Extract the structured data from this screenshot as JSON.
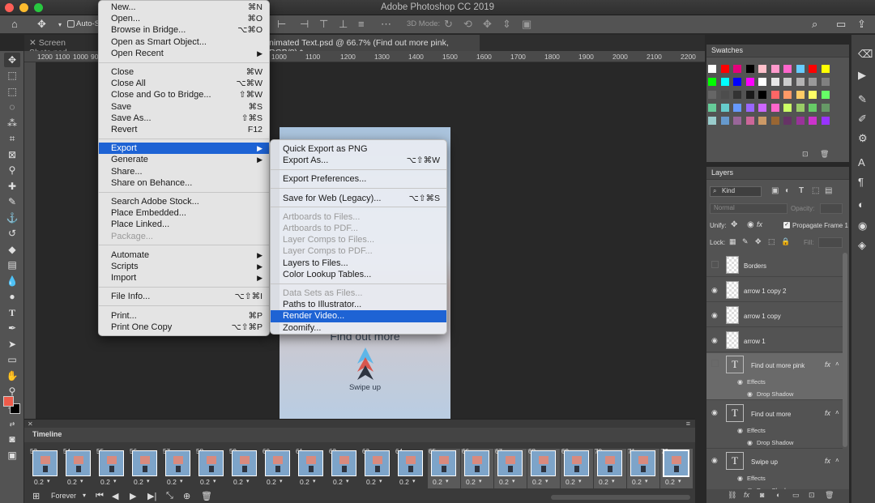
{
  "app": {
    "title": "Adobe Photoshop CC 2019"
  },
  "options": {
    "auto_select_label": "Auto-Se",
    "mode_3d": "3D Mode:"
  },
  "tabs": [
    {
      "label": "Screen Shots.psd"
    },
    {
      "label": "nimated Text.psd @ 66.7% (Find out more pink, RGB/8) *"
    }
  ],
  "ruler": [
    "1200",
    "1100",
    "1000",
    "900",
    "1000",
    "1100",
    "1200",
    "1300",
    "1400",
    "1500",
    "1600",
    "1700",
    "1800",
    "1900",
    "2000",
    "2100",
    "2200"
  ],
  "file_menu": {
    "groups": [
      [
        {
          "label": "New...",
          "shortcut": "⌘N"
        },
        {
          "label": "Open...",
          "shortcut": "⌘O"
        },
        {
          "label": "Browse in Bridge...",
          "shortcut": "⌥⌘O"
        },
        {
          "label": "Open as Smart Object...",
          "shortcut": ""
        },
        {
          "label": "Open Recent",
          "shortcut": "",
          "submenu": true
        }
      ],
      [
        {
          "label": "Close",
          "shortcut": "⌘W"
        },
        {
          "label": "Close All",
          "shortcut": "⌥⌘W"
        },
        {
          "label": "Close and Go to Bridge...",
          "shortcut": "⇧⌘W"
        },
        {
          "label": "Save",
          "shortcut": "⌘S"
        },
        {
          "label": "Save As...",
          "shortcut": "⇧⌘S"
        },
        {
          "label": "Revert",
          "shortcut": "F12"
        }
      ],
      [
        {
          "label": "Export",
          "shortcut": "",
          "submenu": true,
          "highlight": true
        },
        {
          "label": "Generate",
          "shortcut": "",
          "submenu": true
        },
        {
          "label": "Share...",
          "shortcut": ""
        },
        {
          "label": "Share on Behance...",
          "shortcut": ""
        }
      ],
      [
        {
          "label": "Search Adobe Stock...",
          "shortcut": ""
        },
        {
          "label": "Place Embedded...",
          "shortcut": ""
        },
        {
          "label": "Place Linked...",
          "shortcut": ""
        },
        {
          "label": "Package...",
          "shortcut": "",
          "disabled": true
        }
      ],
      [
        {
          "label": "Automate",
          "shortcut": "",
          "submenu": true
        },
        {
          "label": "Scripts",
          "shortcut": "",
          "submenu": true
        },
        {
          "label": "Import",
          "shortcut": "",
          "submenu": true
        }
      ],
      [
        {
          "label": "File Info...",
          "shortcut": "⌥⇧⌘I"
        }
      ],
      [
        {
          "label": "Print...",
          "shortcut": "⌘P"
        },
        {
          "label": "Print One Copy",
          "shortcut": "⌥⇧⌘P"
        }
      ]
    ]
  },
  "export_menu": {
    "groups": [
      [
        {
          "label": "Quick Export as PNG",
          "shortcut": ""
        },
        {
          "label": "Export As...",
          "shortcut": "⌥⇧⌘W"
        }
      ],
      [
        {
          "label": "Export Preferences...",
          "shortcut": ""
        }
      ],
      [
        {
          "label": "Save for Web (Legacy)...",
          "shortcut": "⌥⇧⌘S"
        }
      ],
      [
        {
          "label": "Artboards to Files...",
          "shortcut": "",
          "disabled": true
        },
        {
          "label": "Artboards to PDF...",
          "shortcut": "",
          "disabled": true
        },
        {
          "label": "Layer Comps to Files...",
          "shortcut": "",
          "disabled": true
        },
        {
          "label": "Layer Comps to PDF...",
          "shortcut": "",
          "disabled": true
        },
        {
          "label": "Layers to Files...",
          "shortcut": ""
        },
        {
          "label": "Color Lookup Tables...",
          "shortcut": ""
        }
      ],
      [
        {
          "label": "Data Sets as Files...",
          "shortcut": "",
          "disabled": true
        },
        {
          "label": "Paths to Illustrator...",
          "shortcut": ""
        },
        {
          "label": "Render Video...",
          "shortcut": "",
          "highlight": true
        },
        {
          "label": "Zoomify...",
          "shortcut": ""
        }
      ]
    ]
  },
  "artboard": {
    "cta": "Find out more",
    "swipe": "Swipe up"
  },
  "timeline": {
    "title": "Timeline",
    "loop": "Forever",
    "frames": [
      "53",
      "54",
      "55",
      "56",
      "57",
      "58",
      "59",
      "60",
      "61",
      "62",
      "63",
      "64",
      "65",
      "66",
      "67",
      "68",
      "69",
      "70",
      "71",
      "72"
    ],
    "duration": "0.2"
  },
  "swatches": {
    "title": "Swatches",
    "colors": [
      "#ffffff",
      "#ff0000",
      "#e4007c",
      "#000000",
      "#ffc0cb",
      "#ff99cc",
      "#ff66cc",
      "#66ccff",
      "#ff0000",
      "#ffff00",
      "#00ff00",
      "#00ffff",
      "#0000ff",
      "#ff00ff",
      "#ffffff",
      "#e6e6e6",
      "#cccccc",
      "#b3b3b3",
      "#999999",
      "#808080",
      "#666666",
      "#4d4d4d",
      "#333333",
      "#1a1a1a",
      "#000000",
      "#ff6666",
      "#ff9966",
      "#ffcc66",
      "#ffff66",
      "#66ff66",
      "#66cc99",
      "#66cccc",
      "#6699ff",
      "#9966ff",
      "#cc66ff",
      "#ff66cc",
      "#ccff66",
      "#99cc66",
      "#66cc66",
      "#669966",
      "#99cccc",
      "#6699cc",
      "#996699",
      "#cc6699",
      "#cc9966",
      "#996633",
      "#663366",
      "#993399",
      "#cc33cc",
      "#9933ff"
    ]
  },
  "layers": {
    "title": "Layers",
    "filter": "Kind",
    "blend": "Normal",
    "opacity_label": "Opacity:",
    "unify_label": "Unify:",
    "propagate_label": "Propagate Frame 1",
    "lock_label": "Lock:",
    "fill_label": "Fill:",
    "items": [
      {
        "name": "Borders",
        "type": "pixel",
        "visible": false
      },
      {
        "name": "arrow 1 copy 2",
        "type": "pixel",
        "visible": true
      },
      {
        "name": "arrow 1 copy",
        "type": "pixel",
        "visible": true
      },
      {
        "name": "arrow 1",
        "type": "pixel",
        "visible": true
      },
      {
        "name": "Find out more pink",
        "type": "text",
        "visible": false,
        "fx": true,
        "effects": "Effects",
        "effect": "Drop Shadow",
        "selected": true
      },
      {
        "name": "Find out more",
        "type": "text",
        "visible": true,
        "fx": true,
        "effects": "Effects",
        "effect": "Drop Shadow"
      },
      {
        "name": "Swipe up",
        "type": "text",
        "visible": true,
        "fx": true,
        "effects": "Effects",
        "effect": "Drop Shadow"
      }
    ]
  }
}
